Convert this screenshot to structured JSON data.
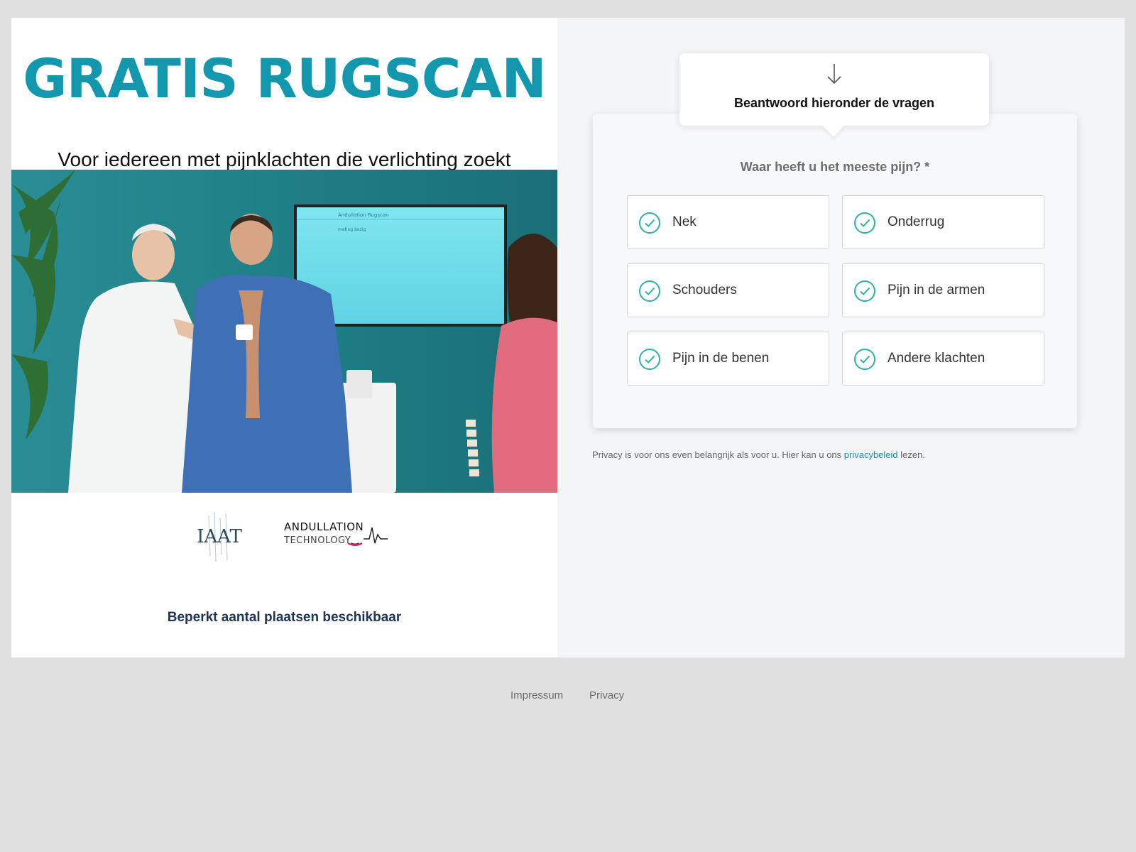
{
  "hero": {
    "title": "GRATIS RUGSCAN",
    "subtitle": "Voor iedereen met pijnklachten die verlichting zoekt",
    "photo_alt": "photo",
    "screen_text": "Andullation Rugscan",
    "screen_subtext": "meting bezig"
  },
  "logos": {
    "iaat": "IAAT",
    "andullation_main": "ANDULLATION",
    "andullation_sub": "TECHNOLOGY"
  },
  "limited_text": "Beperkt aantal plaatsen beschikbaar",
  "form": {
    "callout": "Beantwoord hieronder de vragen",
    "question": "Waar heeft u het meeste pijn? *",
    "options": [
      {
        "label": "Nek"
      },
      {
        "label": "Onderrug"
      },
      {
        "label": "Schouders"
      },
      {
        "label": "Pijn in de armen"
      },
      {
        "label": "Pijn in de benen"
      },
      {
        "label": "Andere klachten"
      }
    ],
    "check_color": "#2bb3a4"
  },
  "privacy": {
    "before": "Privacy is voor ons even belangrijk als voor u. Hier kan u ons ",
    "link": "privacybeleid",
    "after": " lezen."
  },
  "footer": {
    "impressum": "Impressum",
    "privacy": "Privacy"
  },
  "colors": {
    "brand": "#1297ad",
    "background": "#e0e0e0",
    "panel": "#f4f5f6"
  }
}
